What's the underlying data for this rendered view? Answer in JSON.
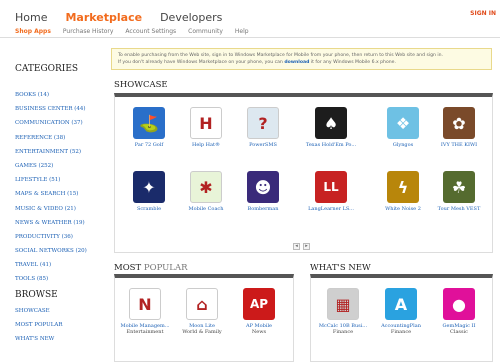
{
  "nav": {
    "items": [
      {
        "label": "Home"
      },
      {
        "label": "Marketplace"
      },
      {
        "label": "Developers"
      }
    ],
    "signin": "SIGN IN",
    "sub": [
      {
        "label": "Shop Apps"
      },
      {
        "label": "Purchase History"
      },
      {
        "label": "Account Settings"
      },
      {
        "label": "Community"
      },
      {
        "label": "Help"
      }
    ]
  },
  "sidebar": {
    "title": "CATEGORIES",
    "categories": [
      "BOOKS (14)",
      "BUSINESS CENTER (44)",
      "COMMUNICATION (37)",
      "REFERENCE (38)",
      "ENTERTAINMENT (52)",
      "GAMES (252)",
      "LIFESTYLE (51)",
      "MAPS & SEARCH (15)",
      "MUSIC & VIDEO (21)",
      "NEWS & WEATHER (19)",
      "PRODUCTIVITY (36)",
      "SOCIAL NETWORKS (20)",
      "TRAVEL (41)",
      "TOOLS (85)"
    ],
    "browse_title": "BROWSE",
    "browse": [
      "SHOWCASE",
      "MOST POPULAR",
      "WHAT'S NEW"
    ]
  },
  "banner": {
    "line1": "To enable purchasing from the Web site, sign in to Windows Marketplace for Mobile from your phone, then return to this Web site and sign in.",
    "line2a": "If you don't already have Windows Marketplace on your phone, you can",
    "line2b": "download",
    "line2c": "it for any Windows Mobile 6.x phone."
  },
  "showcase": {
    "title": "SHOWCASE",
    "apps": [
      {
        "name": "Par 72 Golf",
        "color": "#2a6fc9",
        "glyph": "⛳"
      },
      {
        "name": "Help Hat®",
        "color": "#ffffff",
        "glyph": "H"
      },
      {
        "name": "PowerSMS",
        "color": "#dde8f0",
        "glyph": "?"
      },
      {
        "name": "Texas Hold'Em Po...",
        "color": "#1d1d1d",
        "glyph": "♠"
      },
      {
        "name": "Glyngos",
        "color": "#6ec1e4",
        "glyph": "❖"
      },
      {
        "name": "IVY THE KIWI",
        "color": "#7a4a2a",
        "glyph": "✿"
      },
      {
        "name": "Scramble",
        "color": "#1a2b6a",
        "glyph": "✦"
      },
      {
        "name": "Mobile Coach",
        "color": "#e8f4d8",
        "glyph": "✱"
      },
      {
        "name": "Bomberman",
        "color": "#3a2a7a",
        "glyph": "☻"
      },
      {
        "name": "LangLearner LS...",
        "color": "#c72222",
        "glyph": "LL"
      },
      {
        "name": "White Noise 2",
        "color": "#b8860b",
        "glyph": "ϟ"
      },
      {
        "name": "Tour Mesh VEST",
        "color": "#556b2f",
        "glyph": "☘"
      }
    ]
  },
  "popular": {
    "title_a": "MOST",
    "title_b": "POPULAR",
    "apps": [
      {
        "name": "Mobile Managem...",
        "sub": "Entertainment",
        "color": "#ffffff",
        "glyph": "N"
      },
      {
        "name": "Moon Lite",
        "sub": "World & Family",
        "color": "#ffffff",
        "glyph": "⌂"
      },
      {
        "name": "AP Mobile",
        "sub": "News",
        "color": "#cc1a1a",
        "glyph": "AP"
      }
    ]
  },
  "whatsnew": {
    "title": "WHAT'S NEW",
    "apps": [
      {
        "name": "McCalc 10B Busi...",
        "sub": "Finance",
        "color": "#cfcfcf",
        "glyph": "▦"
      },
      {
        "name": "AccountingPlan",
        "sub": "Finance",
        "color": "#2aa2e0",
        "glyph": "A"
      },
      {
        "name": "GemMagic II",
        "sub": "Classic",
        "color": "#e0109a",
        "glyph": "●"
      }
    ]
  },
  "pager": {
    "prev": "◂",
    "next": "▸"
  }
}
